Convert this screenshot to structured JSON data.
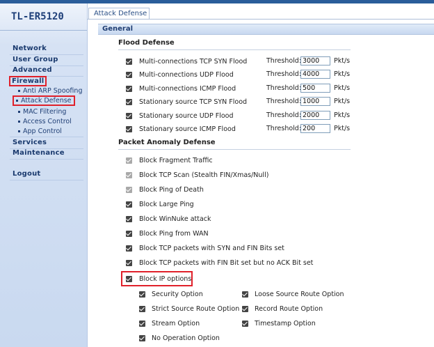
{
  "sidebar": {
    "model": "TL-ER5120",
    "main_items": [
      "Network",
      "User Group",
      "Advanced",
      "Firewall",
      "Services",
      "Maintenance",
      "Logout"
    ],
    "firewall_sub": [
      "Anti ARP Spoofing",
      "Attack Defense",
      "MAC Filtering",
      "Access Control",
      "App Control"
    ]
  },
  "tab": {
    "label": "Attack Defense"
  },
  "section": {
    "title": "General"
  },
  "flood": {
    "title": "Flood Defense",
    "threshold_label": "Threshold:",
    "unit": "Pkt/s",
    "rows": [
      {
        "label": "Multi-connections TCP SYN Flood",
        "value": "3000"
      },
      {
        "label": "Multi-connections UDP Flood",
        "value": "4000"
      },
      {
        "label": "Multi-connections ICMP Flood",
        "value": "500"
      },
      {
        "label": "Stationary source TCP SYN Flood",
        "value": "1000"
      },
      {
        "label": "Stationary source UDP Flood",
        "value": "2000"
      },
      {
        "label": "Stationary source ICMP Flood",
        "value": "200"
      }
    ]
  },
  "anomaly": {
    "title": "Packet Anomaly Defense",
    "items": [
      "Block Fragment Traffic",
      "Block TCP Scan (Stealth FIN/Xmas/Null)",
      "Block Ping of Death",
      "Block Large Ping",
      "Block WinNuke attack",
      "Block Ping from WAN",
      "Block TCP packets with SYN and FIN Bits set",
      "Block TCP packets with FIN Bit set but no ACK Bit set",
      "Block IP options"
    ]
  },
  "ip_options": {
    "left": [
      "Security Option",
      "Strict Source Route Option",
      "Stream Option",
      "No Operation Option"
    ],
    "right": [
      "Loose Source Route Option",
      "Record Route Option",
      "Timestamp Option"
    ]
  },
  "colors": {
    "highlight": "#e0202a",
    "nav_text": "#1a3a6e",
    "topbar": "#2a5d9a"
  }
}
